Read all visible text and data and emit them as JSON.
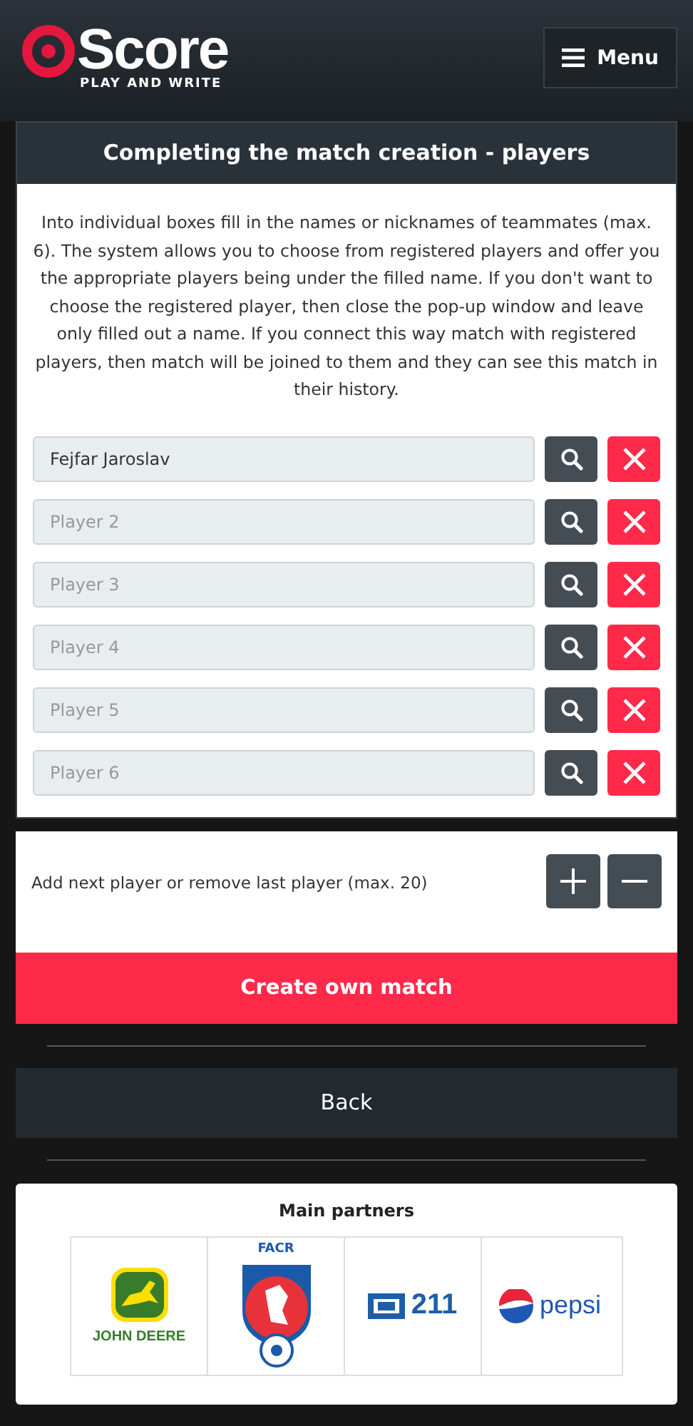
{
  "header": {
    "logo_text": "Score",
    "tagline": "PLAY AND WRITE",
    "menu_label": "Menu"
  },
  "card": {
    "title": "Completing the match creation - players",
    "description": "Into individual boxes fill in the names or nicknames of teammates (max. 6). The system allows you to choose from registered players and offer you the appropriate players being under the filled name. If you don't want to choose the registered player, then close the pop-up window and leave only filled out a name. If you connect this way match with registered players, then match will be joined to them and they can see this match in their history.",
    "players": [
      {
        "value": "Fejfar Jaroslav"
      },
      {
        "placeholder": "Player 2"
      },
      {
        "placeholder": "Player 3"
      },
      {
        "placeholder": "Player 4"
      },
      {
        "placeholder": "Player 5"
      },
      {
        "placeholder": "Player 6"
      }
    ]
  },
  "add_remove": {
    "label": "Add next player or remove last player (max. 20)",
    "create_button": "Create own match"
  },
  "back_button": "Back",
  "partners": {
    "title": "Main partners",
    "items": [
      {
        "kind": "deer",
        "name": "JOHN DEERE"
      },
      {
        "kind": "crest",
        "name": "FACR"
      },
      {
        "kind": "zp",
        "name": "211"
      },
      {
        "kind": "globe",
        "name": "pepsi"
      }
    ]
  }
}
